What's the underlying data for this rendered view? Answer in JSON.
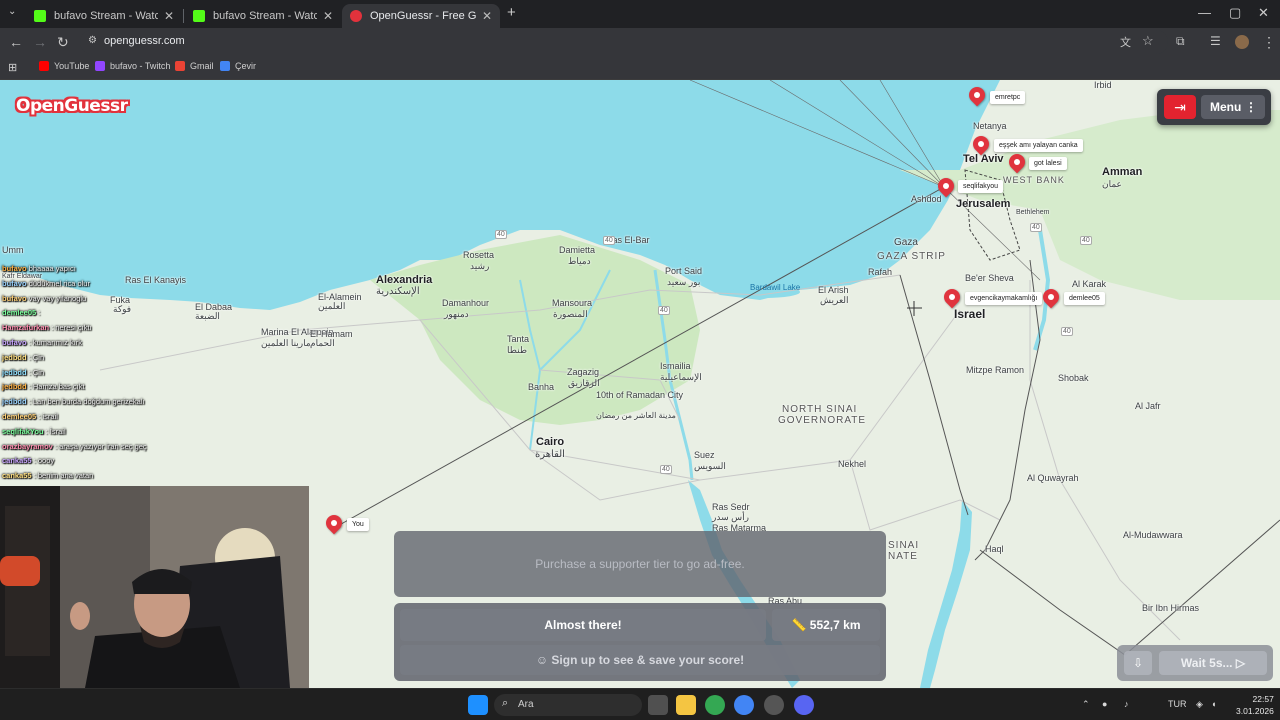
{
  "browser": {
    "tabs": [
      {
        "title": "bufavo Stream - Watch Live on",
        "active": false
      },
      {
        "title": "bufavo Stream - Watch Live on",
        "active": false
      },
      {
        "title": "OpenGuessr - Free GeoGue",
        "active": true
      }
    ],
    "url": "openguessr.com",
    "bookmarks": [
      "YouTube",
      "bufavo - Twitch",
      "Gmail",
      "Çevir"
    ],
    "icons": {
      "back": "←",
      "forward": "→",
      "reload": "↻",
      "newtab": "+",
      "minimize": "—",
      "restore": "▢",
      "close": "✕",
      "star": "☆",
      "menu": "⋮"
    }
  },
  "app": {
    "logo": "OpenGuessr",
    "exit_icon": "⇥",
    "menu_label": "Menu",
    "ad_text": "Purchase a supporter tier to go ad-free.",
    "result_label": "Almost there!",
    "distance": "552,7 km",
    "signup": "Sign up to see & save your score!",
    "wait_label": "Wait 5s...",
    "accent_color": "#e2323c"
  },
  "map": {
    "cities": [
      {
        "name": "Alexandria",
        "big": true
      },
      {
        "name": "الإسكندرية"
      },
      {
        "name": "Cairo",
        "big": true
      },
      {
        "name": "القاهرة"
      },
      {
        "name": "Port Said"
      },
      {
        "name": "بور سعيد"
      },
      {
        "name": "Ismailia"
      },
      {
        "name": "الإسماعيلية"
      },
      {
        "name": "Suez"
      },
      {
        "name": "السويس"
      },
      {
        "name": "10th of Ramadan City"
      },
      {
        "name": "مدينة العاشر من رمضان"
      },
      {
        "name": "Tanta"
      },
      {
        "name": "طنطا"
      },
      {
        "name": "Mansoura"
      },
      {
        "name": "المنصورة"
      },
      {
        "name": "Damietta"
      },
      {
        "name": "دمياط"
      },
      {
        "name": "Damanhour"
      },
      {
        "name": "دمنهور"
      },
      {
        "name": "Zagazig"
      },
      {
        "name": "الزقازيق"
      },
      {
        "name": "Banha"
      },
      {
        "name": "Tel Aviv",
        "big": true
      },
      {
        "name": "Jerusalem",
        "big": true
      },
      {
        "name": "Amman",
        "big": true
      },
      {
        "name": "عمان"
      },
      {
        "name": "Netanya"
      },
      {
        "name": "Ashdod"
      },
      {
        "name": "Gaza"
      },
      {
        "name": "GAZA STRIP"
      },
      {
        "name": "Rafah"
      },
      {
        "name": "Be'er Sheva"
      },
      {
        "name": "Israel",
        "country": true
      },
      {
        "name": "Mitzpe Ramon"
      },
      {
        "name": "Nekhel"
      },
      {
        "name": "Ras Sedr"
      },
      {
        "name": "رأس سدر"
      },
      {
        "name": "Ras Matarma"
      },
      {
        "name": "Ras Abu"
      },
      {
        "name": "Irbid"
      },
      {
        "name": "Bethlehem"
      },
      {
        "name": "Al Karak"
      },
      {
        "name": "Shobak"
      },
      {
        "name": "Al Jafr"
      },
      {
        "name": "Al Quwayrah"
      },
      {
        "name": "Haql"
      },
      {
        "name": "Al-Mudawwara"
      },
      {
        "name": "Bir Ibn Hirmas"
      },
      {
        "name": "El Dabaa"
      },
      {
        "name": "الضبعة"
      },
      {
        "name": "El-Alamein"
      },
      {
        "name": "العلمين"
      },
      {
        "name": "Marina El Alamein"
      },
      {
        "name": "مارينا العلمين"
      },
      {
        "name": "El-Hamam"
      },
      {
        "name": "الحمام"
      },
      {
        "name": "Rosetta"
      },
      {
        "name": "رشيد"
      },
      {
        "name": "Ras El-Bar"
      },
      {
        "name": "Bardawil Lake"
      },
      {
        "name": "El Arish"
      },
      {
        "name": "العريش"
      },
      {
        "name": "NORTH SINAI"
      },
      {
        "name": "GOVERNORATE"
      },
      {
        "name": "SINAI"
      },
      {
        "name": "NATE"
      },
      {
        "name": "WEST BANK"
      },
      {
        "name": "Umm"
      },
      {
        "name": "Ras El Kanayis"
      },
      {
        "name": "Fuka"
      },
      {
        "name": "فوكة"
      },
      {
        "name": "Kafr Eldawar"
      }
    ],
    "pins": [
      {
        "label": "emretpc"
      },
      {
        "label": "eşşek amı yalayan canka"
      },
      {
        "label": "got lalesi"
      },
      {
        "label": "seqlifakyou"
      },
      {
        "label": "evgencikaymakamlığı"
      },
      {
        "label": "demlee05"
      },
      {
        "label": "You"
      }
    ],
    "road_numbers": [
      "40",
      "40",
      "40",
      "40",
      "40",
      "40",
      "40"
    ]
  },
  "chat": [
    {
      "user": "bufavo",
      "text": "bhaaaa yapıcı"
    },
    {
      "user": "bufavo",
      "text": "düdükmel rica olur"
    },
    {
      "user": "bufavo",
      "text": "vay vay yılanoglu"
    },
    {
      "user": "demlee05",
      "text": ":"
    },
    {
      "user": "Hamzafurkan",
      "text": ": neresi çıktı"
    },
    {
      "user": "bufavo",
      "text": ": kumarımız kırk"
    },
    {
      "user": "jedbdd",
      "text": ": Çin"
    },
    {
      "user": "jedbdd",
      "text": ": Çin"
    },
    {
      "user": "jedbdd",
      "text": ": Hamza bas çıkt"
    },
    {
      "user": "jedbdd",
      "text": ": Lan ben burda doğdum gerizekalı"
    },
    {
      "user": "demlee05",
      "text": ": israil"
    },
    {
      "user": "seqlifakYou",
      "text": ": İsrail"
    },
    {
      "user": "orazbayramov",
      "text": ": araşa yazıyor iran seç geç"
    },
    {
      "user": "canka55",
      "text": ": oooy"
    },
    {
      "user": "canka55",
      "text": ": benim ana vatan"
    }
  ],
  "taskbar": {
    "search_placeholder": "Ara",
    "language": "TUR",
    "time": "22:57",
    "date": "3.01.2026"
  }
}
